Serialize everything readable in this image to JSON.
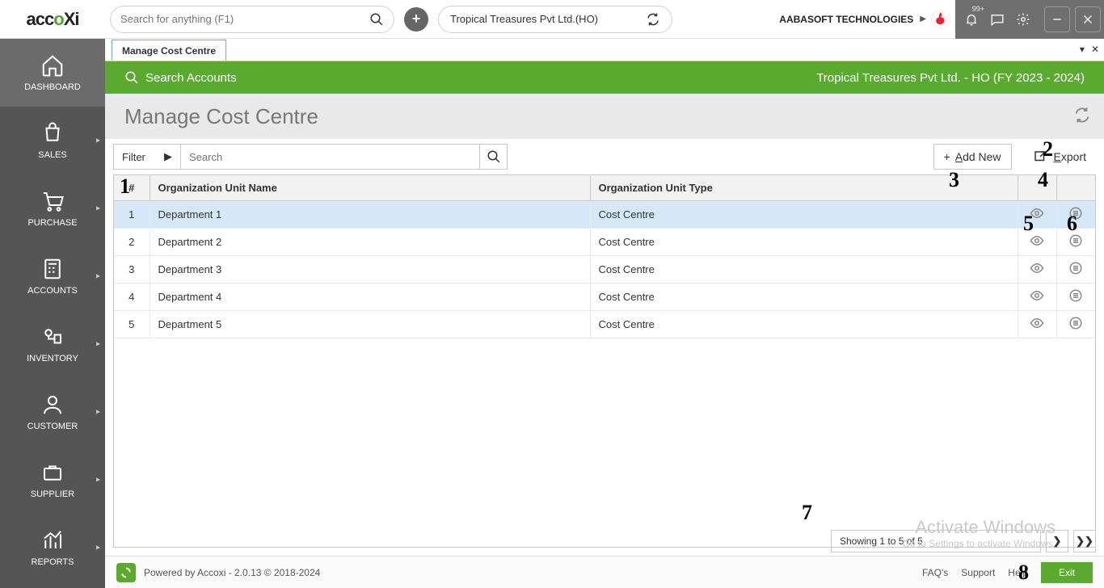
{
  "topbar": {
    "logo_part1": "acc",
    "logo_part2": "o",
    "logo_part3": "Xi",
    "search_placeholder": "Search for anything (F1)",
    "company": "Tropical Treasures Pvt Ltd.(HO)",
    "user": "AABASOFT TECHNOLOGIES",
    "notif_badge": "99+"
  },
  "sidebar": {
    "items": [
      {
        "label": "DASHBOARD"
      },
      {
        "label": "SALES"
      },
      {
        "label": "PURCHASE"
      },
      {
        "label": "ACCOUNTS"
      },
      {
        "label": "INVENTORY"
      },
      {
        "label": "CUSTOMER"
      },
      {
        "label": "SUPPLIER"
      },
      {
        "label": "REPORTS"
      }
    ]
  },
  "tab": {
    "label": "Manage Cost Centre"
  },
  "greenbar": {
    "search": "Search Accounts",
    "context": "Tropical Treasures Pvt Ltd. - HO (FY 2023 - 2024)"
  },
  "page": {
    "title": "Manage Cost Centre"
  },
  "toolbar": {
    "filter": "Filter",
    "search_placeholder": "Search",
    "addnew_prefix": "A",
    "addnew_rest": "dd New",
    "export_prefix": "E",
    "export_rest": "xport"
  },
  "table": {
    "headers": {
      "num": "#",
      "name": "Organization Unit Name",
      "type": "Organization Unit Type"
    },
    "rows": [
      {
        "num": "1",
        "name": "Department 1",
        "type": "Cost Centre"
      },
      {
        "num": "2",
        "name": "Department 2",
        "type": "Cost Centre"
      },
      {
        "num": "3",
        "name": "Department 3",
        "type": "Cost Centre"
      },
      {
        "num": "4",
        "name": "Department 4",
        "type": "Cost Centre"
      },
      {
        "num": "5",
        "name": "Department 5",
        "type": "Cost Centre"
      }
    ]
  },
  "pager": {
    "info": "Showing 1 to 5 of 5"
  },
  "watermark": {
    "line1": "Activate Windows",
    "line2": "Go to Settings to activate Windows."
  },
  "footer": {
    "powered": "Powered by Accoxi - 2.0.13 © 2018-2024",
    "faq": "FAQ's",
    "support": "Support",
    "help": "Help",
    "exit": "Exit"
  },
  "annotations": {
    "a1": "1",
    "a2": "2",
    "a3": "3",
    "a4": "4",
    "a5": "5",
    "a6": "6",
    "a7": "7",
    "a8": "8"
  }
}
